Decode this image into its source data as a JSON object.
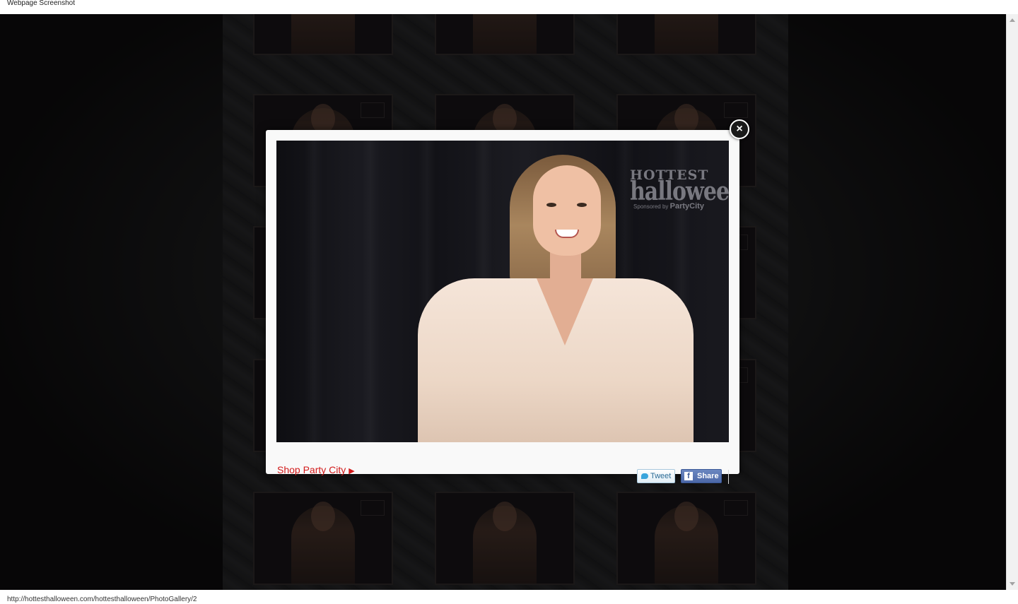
{
  "window": {
    "caption": "Webpage Screenshot"
  },
  "status_bar": {
    "url": "http://hottesthalloween.com/hottesthalloween/PhotoGallery/2"
  },
  "modal": {
    "shop_link": "Shop Party City",
    "shop_arrow": "▶",
    "tweet_label": "Tweet",
    "share_label": "Share",
    "close_glyph": "×",
    "watermark": {
      "line1": "HOTTEST",
      "line2": "halloween",
      "sponsor_prefix": "Sponsored by",
      "sponsor_name": "PartyCity"
    }
  },
  "icons": {
    "close": "close-icon",
    "tweet": "twitter-bird-icon",
    "share": "facebook-icon"
  },
  "colors": {
    "shop_link": "#d21a1a",
    "facebook": "#3b5998",
    "twitter": "#3aa5dc"
  }
}
